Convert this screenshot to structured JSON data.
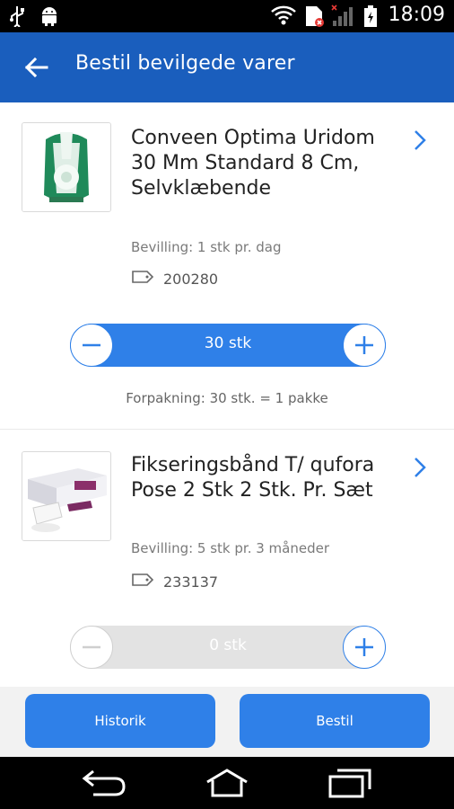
{
  "status_bar": {
    "time": "18:09",
    "icons": [
      "usb-icon",
      "android-debug-icon",
      "wifi-icon",
      "sim-icon",
      "signal-icon",
      "battery-icon"
    ]
  },
  "app_bar": {
    "title": "Bestil bevilgede varer",
    "back_icon": "arrow-left-icon",
    "color": "#1a5ebd"
  },
  "items": [
    {
      "name": "Conveen Optima Uridom 30 Mm Standard 8 Cm, Selvklæbende",
      "allowance": "Bevilling: 1 stk pr. dag",
      "product_number": "200280",
      "quantity": "30 stk",
      "packaging": "Forpakning: 30 stk. = 1 pakke",
      "stepper_active": true
    },
    {
      "name": "Fikseringsbånd T/ qufora Pose 2 Stk 2 Stk. Pr. Sæt",
      "allowance": "Bevilling: 5 stk pr. 3 måneder",
      "product_number": "233137",
      "quantity": "0 stk",
      "stepper_active": false
    }
  ],
  "bottom_buttons": {
    "history": "Historik",
    "order": "Bestil"
  },
  "accent_color": "#2f80e8"
}
